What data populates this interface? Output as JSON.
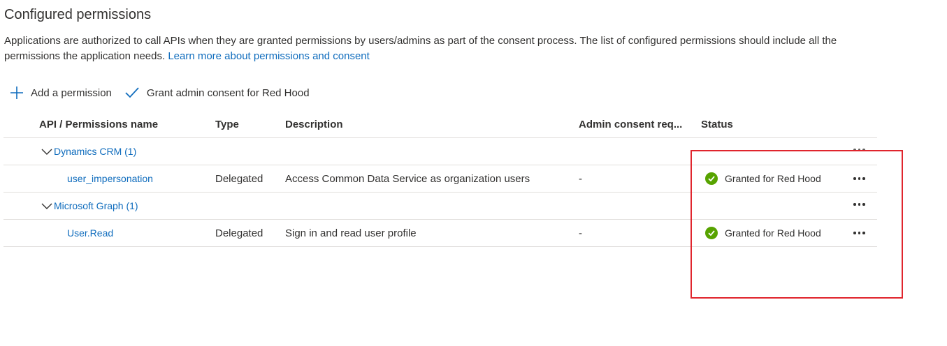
{
  "section": {
    "title": "Configured permissions",
    "description": "Applications are authorized to call APIs when they are granted permissions by users/admins as part of the consent process. The list of configured permissions should include all the permissions the application needs.",
    "learn_more_link": "Learn more about permissions and consent"
  },
  "toolbar": {
    "add_permission_label": "Add a permission",
    "grant_consent_label": "Grant admin consent for Red Hood"
  },
  "table": {
    "columns": {
      "name": "API / Permissions name",
      "type": "Type",
      "description": "Description",
      "admin_consent": "Admin consent req...",
      "status": "Status"
    },
    "groups": [
      {
        "name": "Dynamics CRM (1)",
        "permissions": [
          {
            "name": "user_impersonation",
            "type": "Delegated",
            "description": "Access Common Data Service as organization users",
            "admin_consent": "-",
            "status": "Granted for Red Hood"
          }
        ]
      },
      {
        "name": "Microsoft Graph (1)",
        "permissions": [
          {
            "name": "User.Read",
            "type": "Delegated",
            "description": "Sign in and read user profile",
            "admin_consent": "-",
            "status": "Granted for Red Hood"
          }
        ]
      }
    ]
  },
  "colors": {
    "link": "#0f6cbd",
    "granted": "#57a300",
    "highlight_border": "#e0252d",
    "divider": "#e1dfdd"
  },
  "icons": {
    "add": "plus-icon",
    "grant": "checkmark-icon",
    "expand": "chevron-down-icon",
    "status": "check-circle-icon",
    "more": "more-horizontal-icon"
  }
}
